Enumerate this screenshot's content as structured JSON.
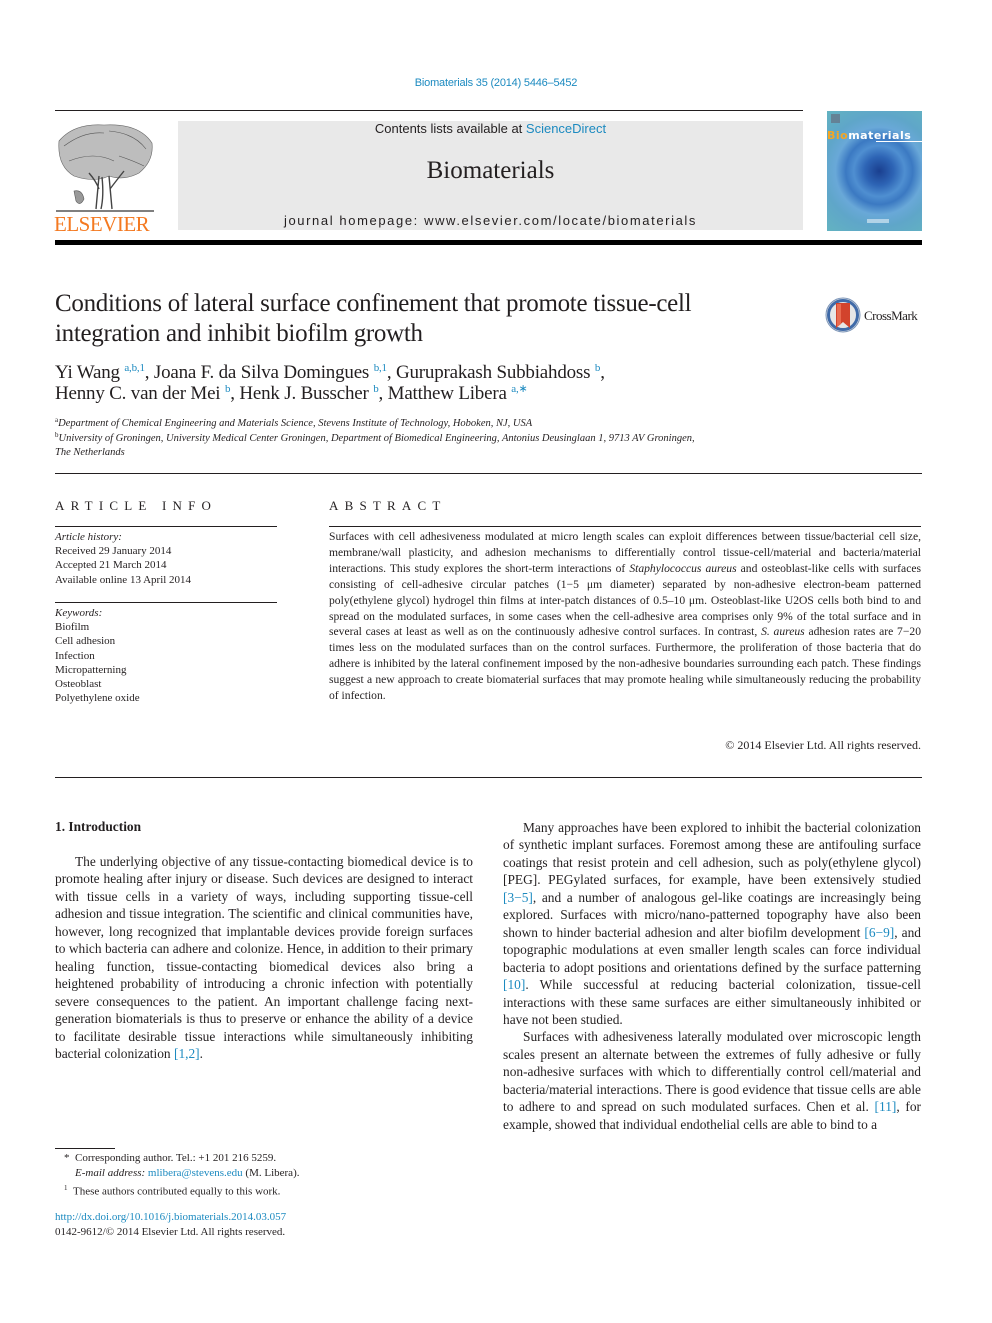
{
  "header": {
    "journal_ref": "Biomaterials 35 (2014) 5446–5452",
    "publisher_logo": "ELSEVIER",
    "contents_prefix": "Contents lists available at ",
    "contents_link": "ScienceDirect",
    "journal_name": "Biomaterials",
    "homepage": "journal homepage: www.elsevier.com/locate/biomaterials",
    "cover": {
      "title_highlight": "Bio",
      "title_rest": "materials"
    },
    "colors": {
      "link": "#1c8ac0",
      "elsevier_orange": "#f47920",
      "masthead_bg": "#e9e9e9"
    }
  },
  "article": {
    "title_line1": "Conditions of lateral surface confinement that promote tissue-cell",
    "title_line2": "integration and inhibit biofilm growth",
    "crossmark_label": "CrossMark",
    "authors": [
      {
        "name": "Yi Wang",
        "sup": "a,b,1",
        "sep": ", "
      },
      {
        "name": "Joana F. da Silva Domingues",
        "sup": "b,1",
        "sep": ", "
      },
      {
        "name": "Guruprakash Subbiahdoss",
        "sup": "b",
        "sep": ","
      },
      {
        "name": "Henny C. van der Mei",
        "sup": "b",
        "sep": ", "
      },
      {
        "name": "Henk J. Busscher",
        "sup": "b",
        "sep": ", "
      },
      {
        "name": "Matthew Libera",
        "sup": "a,∗",
        "sep": ""
      }
    ],
    "affiliations": [
      {
        "mark": "a",
        "text": "Department of Chemical Engineering and Materials Science, Stevens Institute of Technology, Hoboken, NJ, USA"
      },
      {
        "mark": "b",
        "text": "University of Groningen, University Medical Center Groningen, Department of Biomedical Engineering, Antonius Deusinglaan 1, 9713 AV Groningen,",
        "text2": "The Netherlands"
      }
    ]
  },
  "article_info": {
    "heading": "ARTICLE INFO",
    "history_label": "Article history:",
    "history": [
      "Received 29 January 2014",
      "Accepted 21 March 2014",
      "Available online 13 April 2014"
    ],
    "keywords_label": "Keywords:",
    "keywords": [
      "Biofilm",
      "Cell adhesion",
      "Infection",
      "Micropatterning",
      "Osteoblast",
      "Polyethylene oxide"
    ]
  },
  "abstract": {
    "heading": "ABSTRACT",
    "p1": "Surfaces with cell adhesiveness modulated at micro length scales can exploit differences between tissue/bacterial cell size, membrane/wall plasticity, and adhesion mechanisms to differentially control tissue-cell/material and bacteria/material interactions. This study explores the short-term interactions of ",
    "species": "Staphylococcus aureus",
    "p2": " and osteoblast-like cells with surfaces consisting of cell-adhesive circular patches (1−5 μm diameter) separated by non-adhesive electron-beam patterned poly(ethylene glycol) hydrogel thin films at inter-patch distances of 0.5–10 μm. Osteoblast-like U2OS cells both bind to and spread on the modulated surfaces, in some cases when the cell-adhesive area comprises only 9% of the total surface and in several cases at least as well as on the continuously adhesive control surfaces. In contrast, ",
    "species_short": "S. aureus",
    "p3": " adhesion rates are 7−20 times less on the modulated surfaces than on the control surfaces. Furthermore, the proliferation of those bacteria that do adhere is inhibited by the lateral confinement imposed by the non-adhesive boundaries surrounding each patch. These findings suggest a new approach to create biomaterial surfaces that may promote healing while simultaneously reducing the probability of infection.",
    "copyright": "© 2014 Elsevier Ltd. All rights reserved."
  },
  "intro": {
    "heading": "1.  Introduction",
    "para1_text": "The underlying objective of any tissue-contacting biomedical device is to promote healing after injury or disease. Such devices are designed to interact with tissue cells in a variety of ways, including supporting tissue-cell adhesion and tissue integration. The scientific and clinical communities have, however, long recognized that implantable devices provide foreign surfaces to which bacteria can adhere and colonize. Hence, in addition to their primary healing function, tissue-contacting biomedical devices also bring a heightened probability of introducing a chronic infection with potentially severe consequences to the patient. An important challenge facing next-generation biomaterials is thus to preserve or enhance the ability of a device to facilitate desirable tissue interactions while simultaneously inhibiting bacterial colonization ",
    "para1_ref": "[1,2]",
    "para1_end": ".",
    "para2_a": "Many approaches have been explored to inhibit the bacterial colonization of synthetic implant surfaces. Foremost among these are antifouling surface coatings that resist protein and cell adhesion, such as poly(ethylene glycol) [PEG]. PEGylated surfaces, for example, have been extensively studied ",
    "para2_ref1": "[3−5]",
    "para2_b": ", and a number of analogous gel-like coatings are increasingly being explored. Surfaces with micro/nano-patterned topography have also been shown to hinder bacterial adhesion and alter biofilm development ",
    "para2_ref2": "[6−9]",
    "para2_c": ", and topographic modulations at even smaller length scales can force individual bacteria to adopt positions and orientations defined by the surface patterning ",
    "para2_ref3": "[10]",
    "para2_d": ". While successful at reducing bacterial colonization, tissue-cell interactions with these same surfaces are either simultaneously inhibited or have not been studied.",
    "para3_a": "Surfaces with adhesiveness laterally modulated over microscopic length scales present an alternate between the extremes of fully adhesive or fully non-adhesive surfaces with which to differentially control cell/material and bacteria/material interactions. There is good evidence that tissue cells are able to adhere to and spread on such modulated surfaces. Chen et al. ",
    "para3_ref": "[11]",
    "para3_b": ", for example, showed that individual endothelial cells are able to bind to a"
  },
  "footnotes": {
    "corr_mark": "*",
    "corr_text": "Corresponding author. Tel.: +1 201 216 5259.",
    "email_label": "E-mail address:",
    "email": "mlibera@stevens.edu",
    "email_suffix": " (M. Libera).",
    "equal_mark": "1",
    "equal_text": "These authors contributed equally to this work.",
    "doi": "http://dx.doi.org/10.1016/j.biomaterials.2014.03.057",
    "issn": "0142-9612/© 2014 Elsevier Ltd. All rights reserved."
  }
}
